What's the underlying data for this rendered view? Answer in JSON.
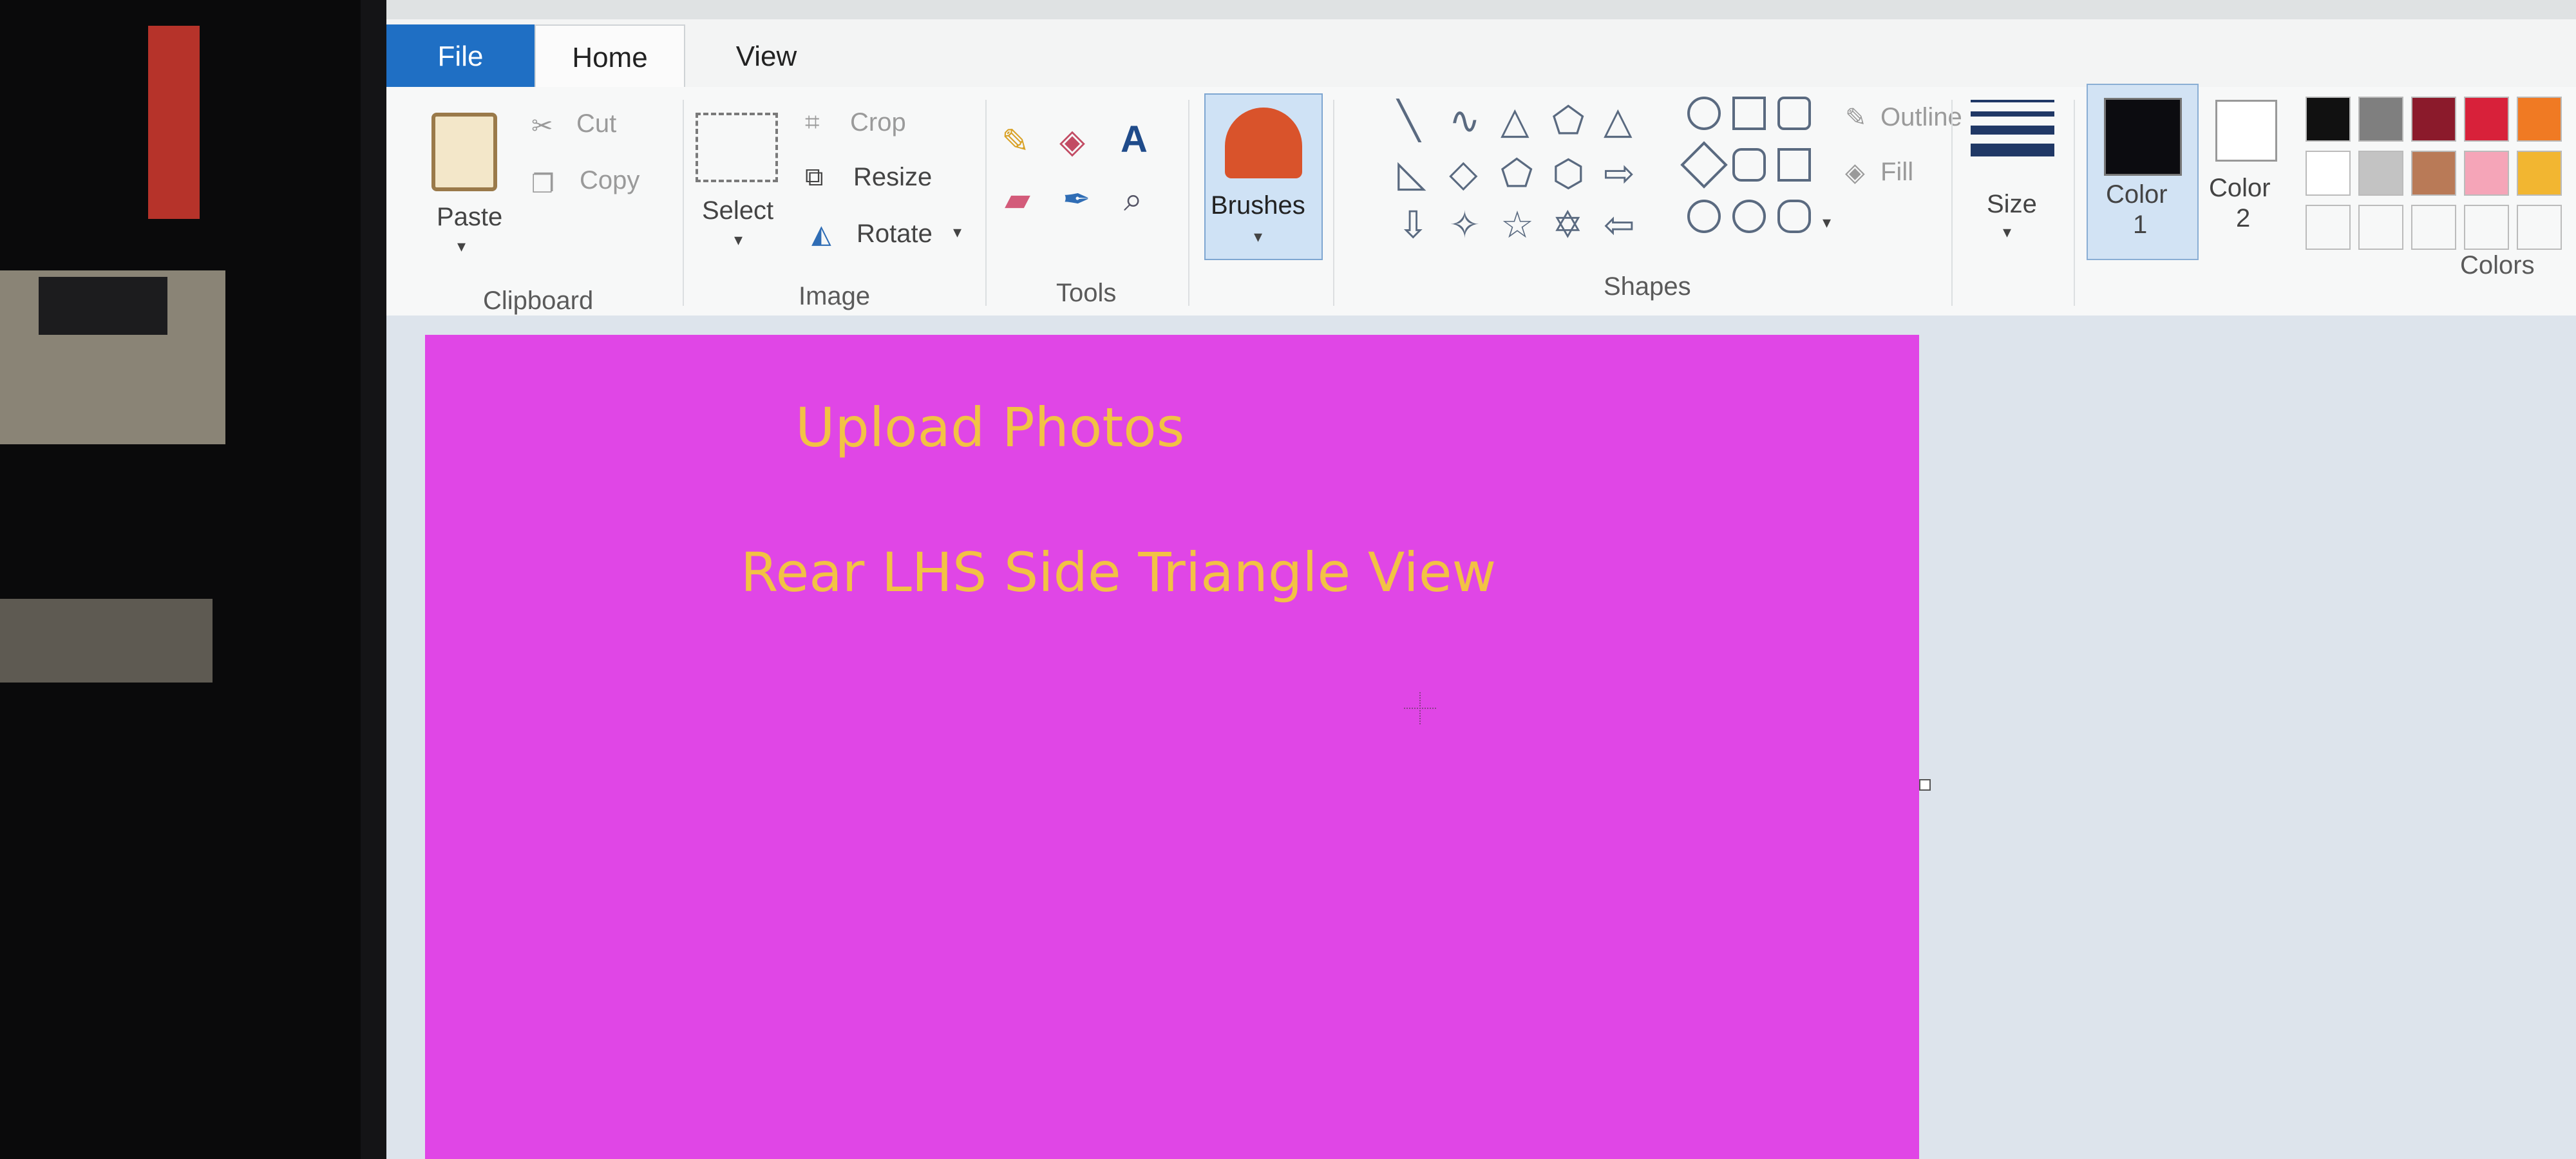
{
  "tabs": {
    "file": "File",
    "home": "Home",
    "view": "View"
  },
  "clipboard": {
    "paste": "Paste",
    "cut": "Cut",
    "copy": "Copy",
    "group": "Clipboard"
  },
  "image": {
    "select": "Select",
    "crop": "Crop",
    "resize": "Resize",
    "rotate": "Rotate",
    "group": "Image"
  },
  "tools": {
    "text_icon": "A",
    "group": "Tools"
  },
  "brushes": {
    "label": "Brushes"
  },
  "shapes": {
    "outline": "Outline",
    "fill": "Fill",
    "group": "Shapes"
  },
  "size": {
    "label": "Size"
  },
  "colors": {
    "color1_label": "Color",
    "color1_num": "1",
    "color2_label": "Color",
    "color2_num": "2",
    "group": "Colors",
    "color1_value": "#0c0c10",
    "color2_value": "#ffffff",
    "palette_row1": [
      "#111111",
      "#7f7f7f",
      "#8b1a2b",
      "#d8213a",
      "#f07a23"
    ],
    "palette_row2": [
      "#ffffff",
      "#c3c3c3",
      "#b97a57",
      "#f5a5b8",
      "#f2b631"
    ]
  },
  "canvas": {
    "background": "#e046e6",
    "text_color": "#f2c244",
    "title": "Upload Photos",
    "subtitle": "Rear LHS Side Triangle View"
  }
}
